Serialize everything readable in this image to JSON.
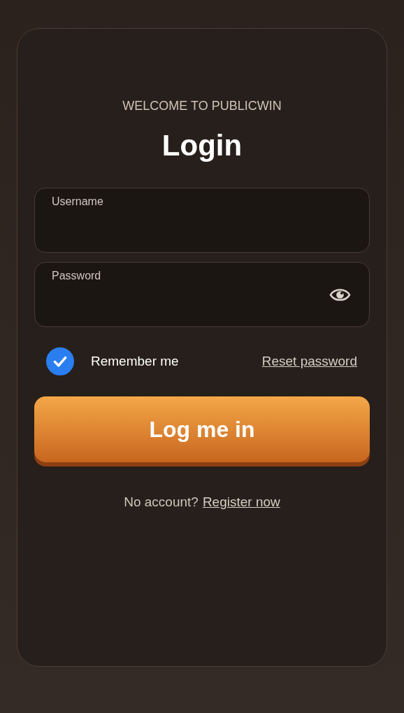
{
  "header": {
    "eyebrow": "WELCOME TO PUBLICWIN",
    "title": "Login"
  },
  "fields": [
    {
      "kind": "text",
      "label": "Username"
    },
    {
      "kind": "password",
      "label": "Password"
    }
  ],
  "remember": {
    "label": "Remember me",
    "checked": true
  },
  "reset_link": "Reset password",
  "submit": "Log me in",
  "footer": {
    "text": "No account?",
    "link": "Register now"
  }
}
